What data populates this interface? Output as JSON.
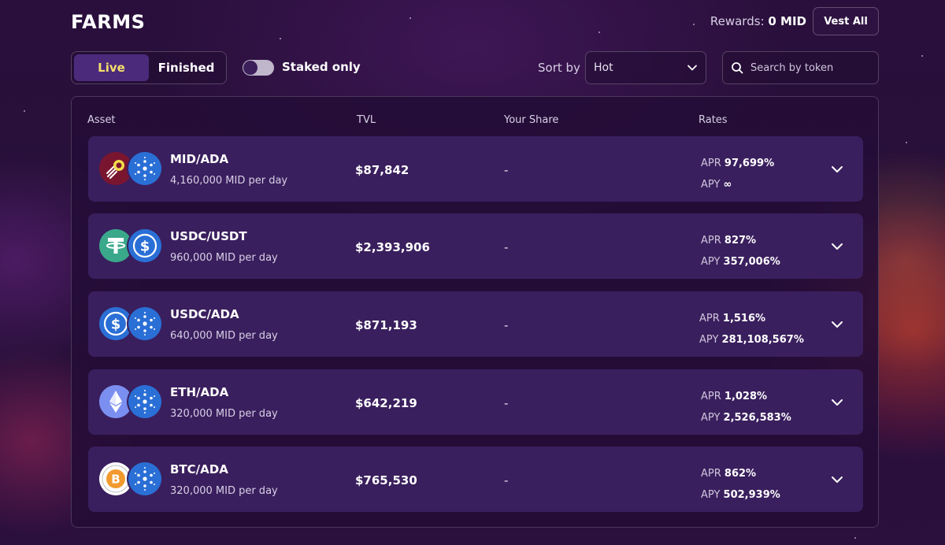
{
  "header": {
    "title": "FARMS",
    "rewards_label": "Rewards:",
    "rewards_value": "0 MID",
    "vest_all_label": "Vest All"
  },
  "filters": {
    "tabs": [
      {
        "label": "Live",
        "active": true
      },
      {
        "label": "Finished",
        "active": false
      }
    ],
    "staked_only_label": "Staked only",
    "staked_only_enabled": false,
    "sort_label": "Sort by",
    "sort_value": "Hot",
    "search_placeholder": "Search by token"
  },
  "table": {
    "headers": {
      "asset": "Asset",
      "tvl": "TVL",
      "share": "Your Share",
      "rates": "Rates"
    },
    "rows": [
      {
        "pair": "MID/ADA",
        "per_day": "4,160,000 MID per day",
        "tvl": "$87,842",
        "share": "-",
        "apr_label": "APR",
        "apr": "97,699%",
        "apy_label": "APY",
        "apy": "∞",
        "icon1": "mid-token-icon",
        "icon2": "ada-token-icon"
      },
      {
        "pair": "USDC/USDT",
        "per_day": "960,000 MID per day",
        "tvl": "$2,393,906",
        "share": "-",
        "apr_label": "APR",
        "apr": "827%",
        "apy_label": "APY",
        "apy": "357,006%",
        "icon1": "usdt-token-icon",
        "icon2": "usdc-token-icon"
      },
      {
        "pair": "USDC/ADA",
        "per_day": "640,000 MID per day",
        "tvl": "$871,193",
        "share": "-",
        "apr_label": "APR",
        "apr": "1,516%",
        "apy_label": "APY",
        "apy": "281,108,567%",
        "icon1": "usdc-token-icon",
        "icon2": "ada-token-icon"
      },
      {
        "pair": "ETH/ADA",
        "per_day": "320,000 MID per day",
        "tvl": "$642,219",
        "share": "-",
        "apr_label": "APR",
        "apr": "1,028%",
        "apy_label": "APY",
        "apy": "2,526,583%",
        "icon1": "eth-token-icon",
        "icon2": "ada-token-icon"
      },
      {
        "pair": "BTC/ADA",
        "per_day": "320,000 MID per day",
        "tvl": "$765,530",
        "share": "-",
        "apr_label": "APR",
        "apr": "862%",
        "apy_label": "APY",
        "apy": "502,939%",
        "icon1": "btc-token-icon",
        "icon2": "ada-token-icon"
      }
    ]
  },
  "colors": {
    "accent_active_tab": "#f5df6a",
    "row_background": "#3a1f5e",
    "panel_background": "#230d37",
    "active_tab_background": "#4b2a7c"
  }
}
